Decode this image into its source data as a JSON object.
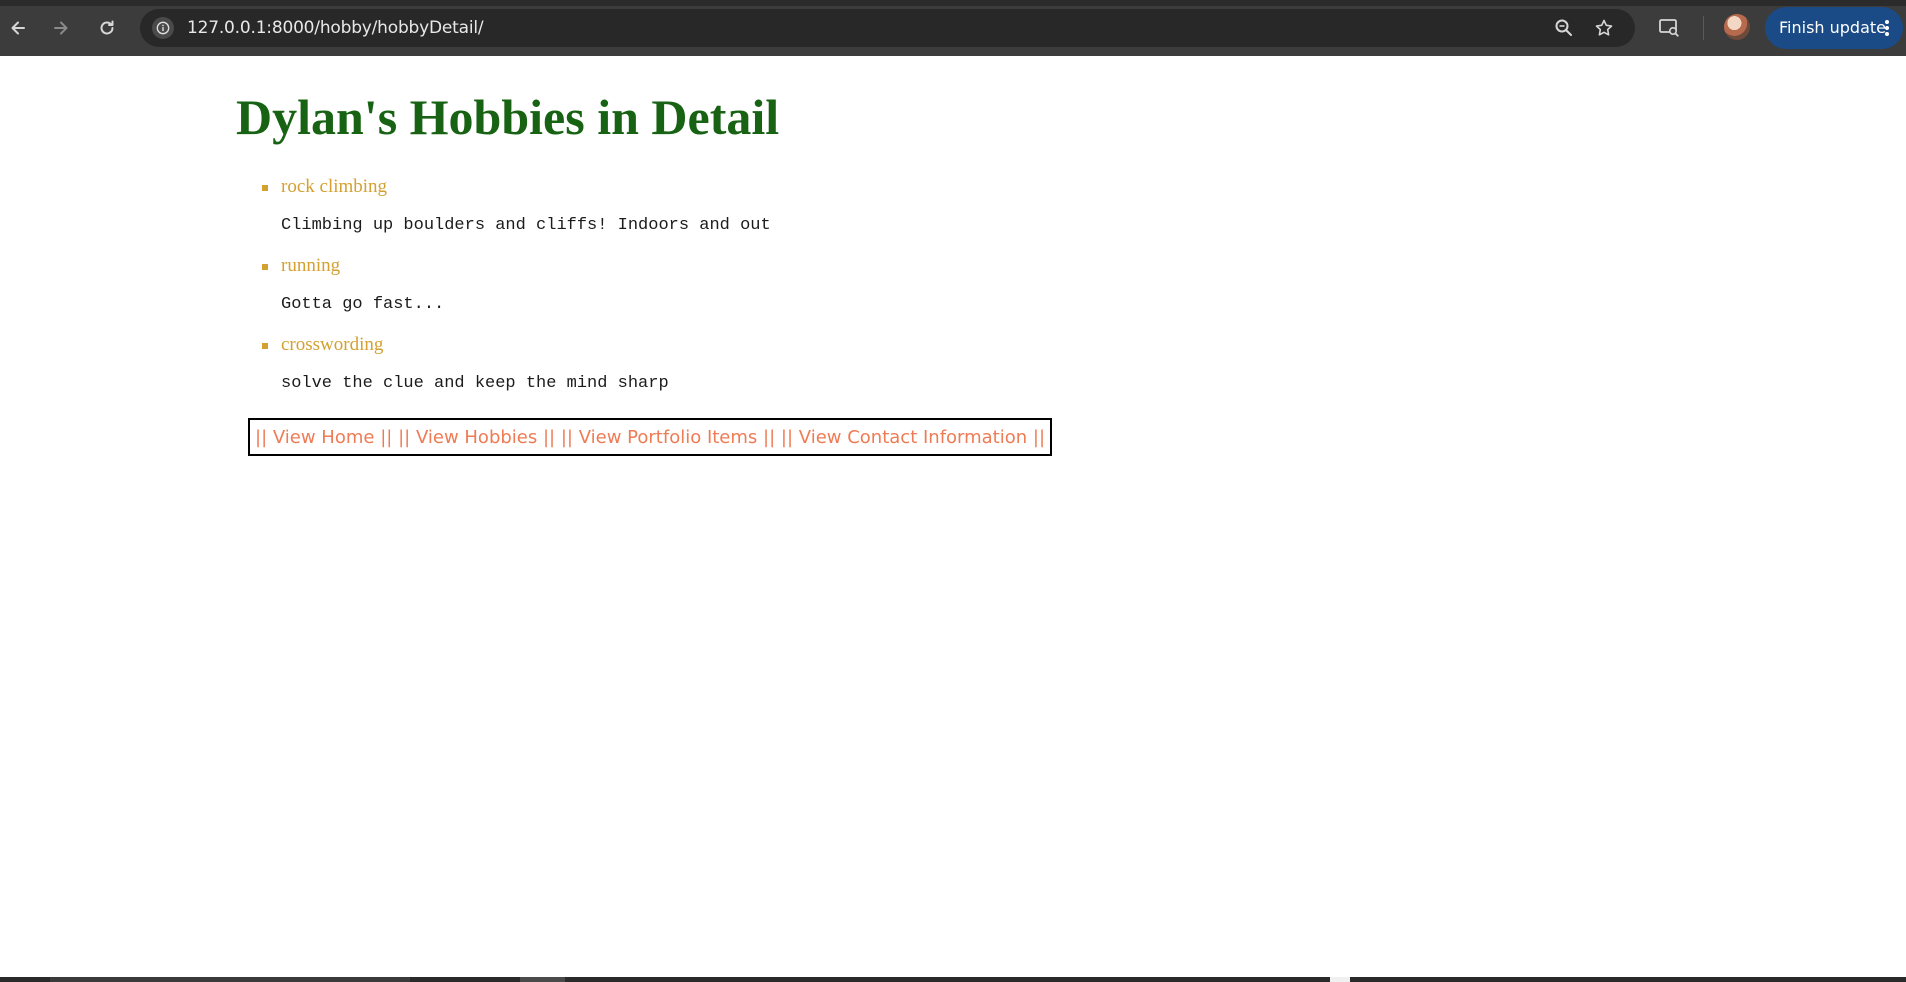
{
  "browser": {
    "url": "127.0.0.1:8000/hobby/hobbyDetail/",
    "update_label": "Finish update",
    "colors": {
      "chrome": "#3c3c3c",
      "omnibox": "#282828",
      "update_button": "#1a4b86"
    }
  },
  "page": {
    "title": "Dylan's Hobbies in Detail",
    "hobbies": [
      {
        "name": "rock climbing",
        "description": "Climbing up boulders and cliffs! Indoors and out"
      },
      {
        "name": "running",
        "description": "Gotta go fast..."
      },
      {
        "name": "crosswording",
        "description": "solve the clue and keep the mind sharp"
      }
    ],
    "nav": {
      "separator": "||",
      "links": [
        "View Home",
        "View Hobbies",
        "View Portfolio Items",
        "View Contact Information"
      ]
    },
    "colors": {
      "title": "#176313",
      "hobby_name": "#d4a030",
      "nav_link": "#ef7b54"
    }
  }
}
